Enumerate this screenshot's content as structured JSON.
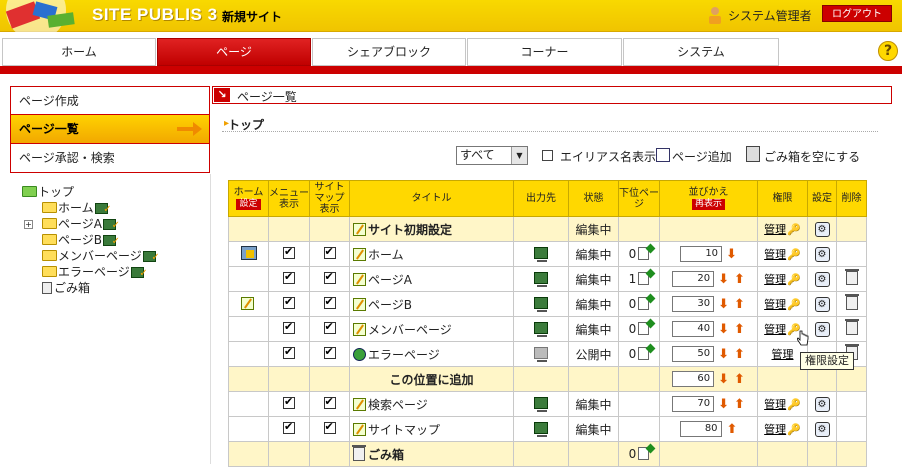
{
  "header": {
    "app_title": "SITE PUBLIS 3",
    "site_name": "新規サイト",
    "user_name": "システム管理者",
    "logout_label": "ログアウト"
  },
  "tabs": [
    {
      "label": "ホーム",
      "active": false
    },
    {
      "label": "ページ",
      "active": true
    },
    {
      "label": "シェアブロック",
      "active": false
    },
    {
      "label": "コーナー",
      "active": false
    },
    {
      "label": "システム",
      "active": false
    }
  ],
  "help_label": "?",
  "sidebar": {
    "items": [
      {
        "label": "ページ作成"
      },
      {
        "label": "ページ一覧"
      },
      {
        "label": "ページ承認・検索"
      }
    ],
    "tree": [
      {
        "label": "トップ"
      },
      {
        "label": "ホーム"
      },
      {
        "label": "ページA"
      },
      {
        "label": "ページB"
      },
      {
        "label": "メンバーページ"
      },
      {
        "label": "エラーページ"
      },
      {
        "label": "ごみ箱"
      }
    ]
  },
  "main": {
    "header_title": "ページ一覧",
    "breadcrumb": "トップ",
    "toolbar": {
      "filter_value": "すべて",
      "alias_label": "エイリアス名表示",
      "add_page_label": "ページ追加",
      "empty_trash_label": "ごみ箱を空にする"
    },
    "columns": {
      "home": "ホーム",
      "home_badge": "設定",
      "menu": "メニュー表示",
      "sitemap": "サイトマップ表示",
      "title": "タイトル",
      "output": "出力先",
      "status": "状態",
      "children": "下位ページ",
      "sort": "並びかえ",
      "sort_badge": "再表示",
      "perm": "権限",
      "setting": "設定",
      "delete": "削除"
    },
    "rows": [
      {
        "title": "サイト初期設定",
        "status": "編集中",
        "perm": "管理"
      },
      {
        "title": "ホーム",
        "status": "編集中",
        "children": "0",
        "order": "10",
        "perm": "管理"
      },
      {
        "title": "ページA",
        "status": "編集中",
        "children": "1",
        "order": "20",
        "perm": "管理"
      },
      {
        "title": "ページB",
        "status": "編集中",
        "children": "0",
        "order": "30",
        "perm": "管理"
      },
      {
        "title": "メンバーページ",
        "status": "編集中",
        "children": "0",
        "order": "40",
        "perm": "管理"
      },
      {
        "title": "エラーページ",
        "status": "公開中",
        "children": "0",
        "order": "50",
        "perm": "管理"
      },
      {
        "title": "この位置に追加",
        "order": "60"
      },
      {
        "title": "検索ページ",
        "status": "編集中",
        "order": "70",
        "perm": "管理"
      },
      {
        "title": "サイトマップ",
        "status": "編集中",
        "order": "80",
        "perm": "管理"
      },
      {
        "title": "ごみ箱",
        "children": "0"
      }
    ],
    "tooltip": "権限設定"
  }
}
